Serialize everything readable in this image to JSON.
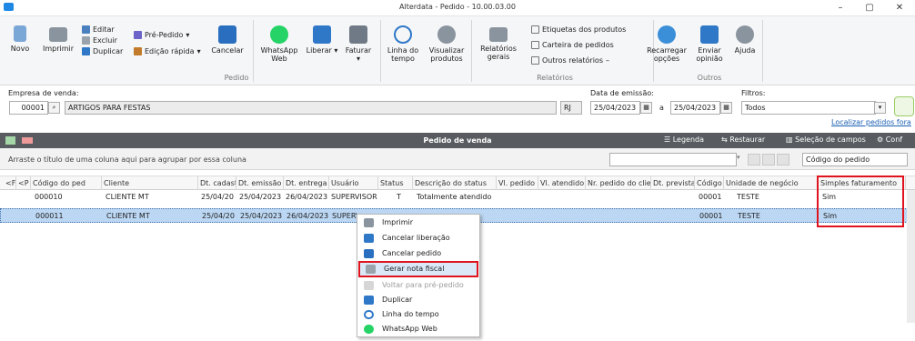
{
  "window": {
    "title": "Alterdata - Pedido - 10.00.03.00",
    "minimize": "–",
    "maximize": "▢",
    "close": "✕"
  },
  "ribbon": {
    "buttons": {
      "novo": "Novo",
      "imprimir": "Imprimir",
      "editar": "Editar",
      "excluir": "Excluir",
      "duplicar": "Duplicar",
      "pre_pedido": "Pré-Pedido",
      "edicao_rapida": "Edição rápida",
      "cancelar": "Cancelar",
      "whatsapp_1": "WhatsApp",
      "whatsapp_2": "Web",
      "liberar": "Liberar",
      "faturar": "Faturar",
      "linha_tempo_1": "Linha do",
      "linha_tempo_2": "tempo",
      "visualizar_1": "Visualizar",
      "visualizar_2": "produtos",
      "relatorios_1": "Relatórios",
      "relatorios_2": "gerais",
      "etiquetas": "Etiquetas dos produtos",
      "carteira": "Carteira de pedidos",
      "outros_relatorios": "Outros relatórios",
      "recarregar_1": "Recarregar",
      "recarregar_2": "opções",
      "enviar_1": "Enviar",
      "enviar_2": "opinião",
      "ajuda": "Ajuda"
    },
    "groups": {
      "pedido": "Pedido",
      "relatorios": "Relatórios",
      "outros": "Outros"
    }
  },
  "filters": {
    "empresa_label": "Empresa de venda:",
    "empresa_code": "00001",
    "empresa_name": "ARTIGOS PARA FESTAS",
    "uf": "RJ",
    "data_label": "Data de emissão:",
    "data_from": "25/04/2023",
    "data_sep": "a",
    "data_to": "25/04/2023",
    "filtros_label": "Filtros:",
    "filtros_value": "Todos",
    "localizar_link": "Localizar pedidos fora"
  },
  "grid": {
    "title": "Pedido de venda",
    "legenda": "Legenda",
    "restaurar": "Restaurar",
    "selecao": "Seleção de campos",
    "config": "Conf",
    "group_hint": "Arraste o título de uma coluna aqui para agrupar por essa coluna",
    "search_field": "Código do pedido",
    "columns": [
      "<F",
      "<P",
      "Código do ped",
      "Cliente",
      "Dt. cadast",
      "Dt. emissão",
      "Dt. entrega",
      "Usuário",
      "Status",
      "Descrição do status",
      "Vl. pedido",
      "Vl. atendido",
      "Nr. pedido do clie",
      "Dt. prevista",
      "Código u",
      "Unidade de negócio",
      "Simples faturamento"
    ],
    "rows": [
      {
        "codigo": "000010",
        "cliente": "CLIENTE MT",
        "cadast": "25/04/20",
        "emissao": "25/04/2023",
        "entrega": "26/04/2023",
        "usuario": "SUPERVISOR",
        "status": "T",
        "descricao": "Totalmente atendido",
        "cod_u": "00001",
        "unidade": "TESTE",
        "simples": "Sim"
      },
      {
        "codigo": "000011",
        "cliente": "CLIENTE MT",
        "cadast": "25/04/20",
        "emissao": "25/04/2023",
        "entrega": "26/04/2023",
        "usuario": "SUPERVISOR",
        "status": "",
        "descricao": "",
        "cod_u": "00001",
        "unidade": "TESTE",
        "simples": "Sim"
      }
    ]
  },
  "context_menu": {
    "imprimir": "Imprimir",
    "cancelar_liberacao": "Cancelar liberação",
    "cancelar_pedido": "Cancelar pedido",
    "gerar_nota": "Gerar nota fiscal",
    "voltar": "Voltar para pré-pedido",
    "duplicar": "Duplicar",
    "linha_tempo": "Linha do tempo",
    "whatsapp": "WhatsApp Web"
  },
  "colors": {
    "accent": "#1e88e5",
    "highlight": "#e0141e",
    "selected_row": "#bcd7f3",
    "header": "#585c60"
  }
}
